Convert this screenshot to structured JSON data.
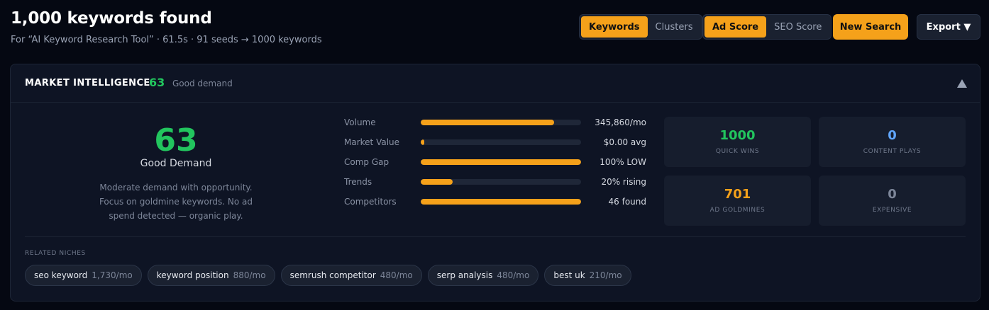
{
  "header": {
    "title": "1,000 keywords found",
    "subtitle": "For “AI Keyword Research Tool” · 61.5s · 91 seeds → 1000 keywords",
    "view_toggle": [
      "Keywords",
      "Clusters"
    ],
    "score_toggle": [
      "Ad Score",
      "SEO Score"
    ],
    "new_search_label": "New Search",
    "export_label": "Export ▼"
  },
  "market": {
    "title": "MARKET INTELLIGENCE",
    "score": "63",
    "status": "Good demand",
    "big_score": "63",
    "big_label": "Good Demand",
    "description": "Moderate demand with opportunity. Focus on goldmine keywords. No ad spend detected — organic play.",
    "metrics": [
      {
        "label": "Volume",
        "value": "345,860/mo",
        "fill": 0.83
      },
      {
        "label": "Market Value",
        "value": "$0.00 avg",
        "fill": 0.02
      },
      {
        "label": "Comp Gap",
        "value": "100% LOW",
        "fill": 1.0
      },
      {
        "label": "Trends",
        "value": "20% rising",
        "fill": 0.2
      },
      {
        "label": "Competitors",
        "value": "46 found",
        "fill": 1.0
      }
    ],
    "stats": [
      {
        "value": "1000",
        "label": "QUICK WINS",
        "color": "#22c55e"
      },
      {
        "value": "0",
        "label": "CONTENT PLAYS",
        "color": "#60a5fa"
      },
      {
        "value": "701",
        "label": "AD GOLDMINES",
        "color": "#f5a11a"
      },
      {
        "value": "0",
        "label": "EXPENSIVE",
        "color": "#7d8699"
      }
    ]
  },
  "niches": {
    "title": "RELATED NICHES",
    "items": [
      {
        "name": "seo keyword",
        "volume": "1,730/mo"
      },
      {
        "name": "keyword position",
        "volume": "880/mo"
      },
      {
        "name": "semrush competitor",
        "volume": "480/mo"
      },
      {
        "name": "serp analysis",
        "volume": "480/mo"
      },
      {
        "name": "best uk",
        "volume": "210/mo"
      }
    ]
  },
  "colors": {
    "accent": "#f5a11a",
    "good": "#22c55e",
    "info": "#60a5fa"
  },
  "icons": {
    "collapse": "chevron-up-icon"
  }
}
